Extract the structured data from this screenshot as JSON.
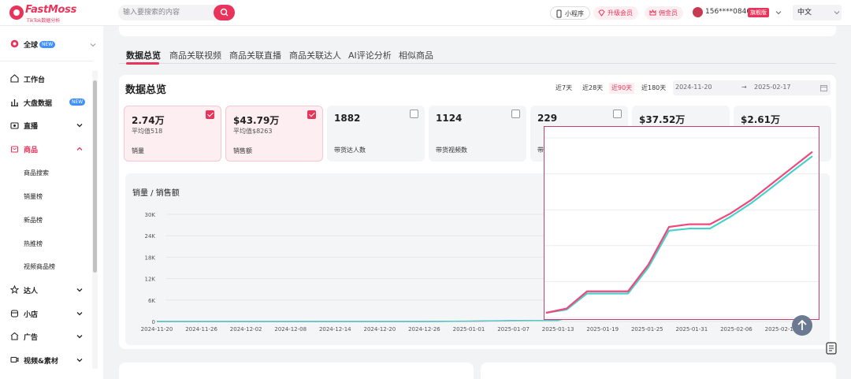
{
  "brand": {
    "name": "FastMoss",
    "sub": "TikTok数据分析"
  },
  "header": {
    "search_placeholder": "输入要搜索的内容",
    "miniprogram_label": "小程序",
    "upgrade_label": "升级会员",
    "commission_label": "佣金员",
    "phone": "156****0846",
    "vip_badge": "旗舰版",
    "language": "中文"
  },
  "sidebar": {
    "global_label": "全球",
    "global_badge": "NEW",
    "items": [
      {
        "label": "工作台",
        "icon": "home-icon"
      },
      {
        "label": "大盘数据",
        "icon": "bar-chart-icon",
        "badge": "NEW"
      },
      {
        "label": "直播",
        "icon": "live-icon"
      },
      {
        "label": "商品",
        "icon": "bag-icon"
      },
      {
        "label": "达人",
        "icon": "star-icon"
      },
      {
        "label": "小店",
        "icon": "shop-icon"
      },
      {
        "label": "广告",
        "icon": "ad-icon"
      },
      {
        "label": "视频&素材",
        "icon": "video-icon"
      }
    ],
    "product_sub": [
      "商品搜索",
      "销量榜",
      "新品榜",
      "热推榜",
      "视频商品榜"
    ]
  },
  "tabs": [
    "数据总览",
    "商品关联视频",
    "商品关联直播",
    "商品关联达人",
    "AI评论分析",
    "相似商品"
  ],
  "panel": {
    "title": "数据总览",
    "ranges": [
      "近7天",
      "近28天",
      "近90天",
      "近180天"
    ],
    "active_range": "近90天",
    "date_start": "2024-11-20",
    "date_end": "2025-02-17",
    "date_sep": "→"
  },
  "metrics": [
    {
      "value": "2.74万",
      "avg": "平均值518",
      "label": "销量",
      "selected": true
    },
    {
      "value": "$43.79万",
      "avg": "平均值$8263",
      "label": "销售额",
      "selected": true
    },
    {
      "value": "1882",
      "avg": "",
      "label": "带货达人数",
      "selected": false
    },
    {
      "value": "1124",
      "avg": "",
      "label": "带货视频数",
      "selected": false
    },
    {
      "value": "229",
      "avg": "",
      "label": "带",
      "selected": false
    },
    {
      "value": "$37.52万",
      "avg": "",
      "label": "",
      "selected": false
    },
    {
      "value": "$2.61万",
      "avg": "",
      "label": "",
      "selected": false
    }
  ],
  "colors": {
    "accent": "#e8335a",
    "series_sales_volume": "#f0487a",
    "series_sales_amount": "#48d1cc"
  },
  "chart_data": {
    "type": "line",
    "title": "销量 / 销售额",
    "ylim": [
      0,
      30000
    ],
    "yticks": [
      "0",
      "6K",
      "12K",
      "18K",
      "24K",
      "30K"
    ],
    "x": [
      "2024-11-20",
      "2024-11-26",
      "2024-12-02",
      "2024-12-08",
      "2024-12-14",
      "2024-12-20",
      "2024-12-26",
      "2025-01-01",
      "2025-01-07",
      "2025-01-13",
      "2025-01-19",
      "2025-01-25",
      "2025-01-31",
      "2025-02-06",
      "2025-02-12"
    ],
    "series": [
      {
        "values": [
          0,
          0,
          0,
          0,
          0,
          0,
          0,
          80,
          250,
          300,
          3600,
          3700,
          4200,
          21000,
          27400
        ]
      },
      {
        "values": [
          0,
          0,
          0,
          0,
          0,
          0,
          0,
          60,
          230,
          280,
          3300,
          3400,
          3900,
          20200,
          26500
        ]
      }
    ],
    "grid": true,
    "legend": "none"
  },
  "zoom_data": {
    "series": [
      {
        "values": [
          0,
          800,
          4000,
          4000,
          4000,
          9000,
          16000,
          16500,
          16500,
          18500,
          21000,
          24000,
          27000,
          30000
        ]
      },
      {
        "values": [
          0,
          600,
          3600,
          3600,
          3600,
          8500,
          15300,
          15700,
          15700,
          17900,
          20400,
          23300,
          26300,
          29200
        ]
      }
    ]
  }
}
